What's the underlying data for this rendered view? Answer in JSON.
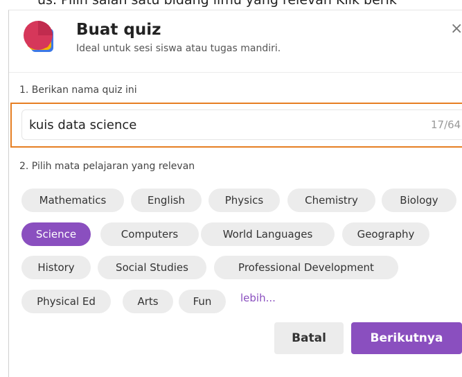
{
  "background_text": "us.  Pilih salah satu bidang ilmu yang relevan  Klik berik",
  "dialog": {
    "title": "Buat quiz",
    "subtitle": "Ideal untuk sesi siswa atau tugas mandiri.",
    "close_icon": "close-icon",
    "logo_icon": "stacked-cards-logo"
  },
  "step1": {
    "label": "1. Berikan nama quiz ini",
    "input_value": "kuis data science",
    "counter": "17/64",
    "highlight_color": "#e67e22"
  },
  "step2": {
    "label": "2. Pilih mata pelajaran yang relevan",
    "subjects": [
      {
        "label": "Mathematics",
        "selected": false
      },
      {
        "label": "English",
        "selected": false
      },
      {
        "label": "Physics",
        "selected": false
      },
      {
        "label": "Chemistry",
        "selected": false
      },
      {
        "label": "Biology",
        "selected": false
      },
      {
        "label": "Science",
        "selected": true
      },
      {
        "label": "Computers",
        "selected": false
      },
      {
        "label": "World Languages",
        "selected": false
      },
      {
        "label": "Geography",
        "selected": false
      },
      {
        "label": "History",
        "selected": false
      },
      {
        "label": "Social Studies",
        "selected": false
      },
      {
        "label": "Professional Development",
        "selected": false
      },
      {
        "label": "Physical Ed",
        "selected": false
      },
      {
        "label": "Arts",
        "selected": false
      },
      {
        "label": "Fun",
        "selected": false
      }
    ],
    "more_label": "lebih..."
  },
  "footer": {
    "cancel_label": "Batal",
    "next_label": "Berikutnya"
  },
  "colors": {
    "accent": "#8a4fbf",
    "chip_bg": "#ececec"
  }
}
